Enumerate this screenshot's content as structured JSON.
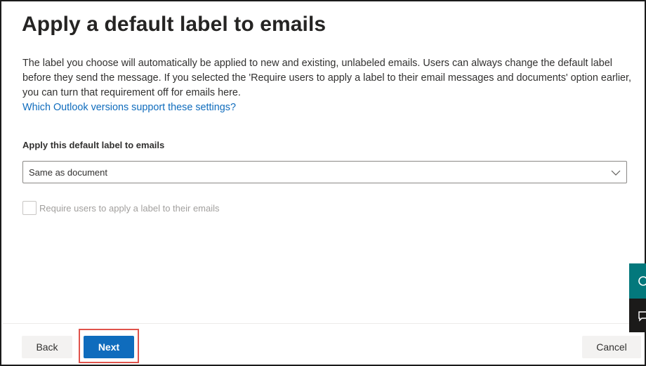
{
  "page": {
    "title": "Apply a default label to emails",
    "description": "The label you choose will automatically be applied to new and existing, unlabeled emails. Users can always change the default label before they send the message. If you selected the 'Require users to apply a label to their email messages and documents' option earlier, you can turn that requirement off for emails here.",
    "help_link": "Which Outlook versions support these settings?"
  },
  "form": {
    "default_label_field": {
      "label": "Apply this default label to emails",
      "selected_value": "Same as document",
      "icon": "chevron-down-icon"
    },
    "require_label_checkbox": {
      "label": "Require users to apply a label to their emails",
      "checked": false,
      "disabled": true
    }
  },
  "side_panel": {
    "buttons": [
      {
        "icon": "help-icon",
        "color": "#03787c"
      },
      {
        "icon": "feedback-icon",
        "color": "#1b1a19"
      }
    ]
  },
  "footer": {
    "back_label": "Back",
    "next_label": "Next",
    "cancel_label": "Cancel",
    "highlight_color": "#e0534c"
  },
  "colors": {
    "accent": "#0f6cbd",
    "link": "#0f6cbd"
  }
}
